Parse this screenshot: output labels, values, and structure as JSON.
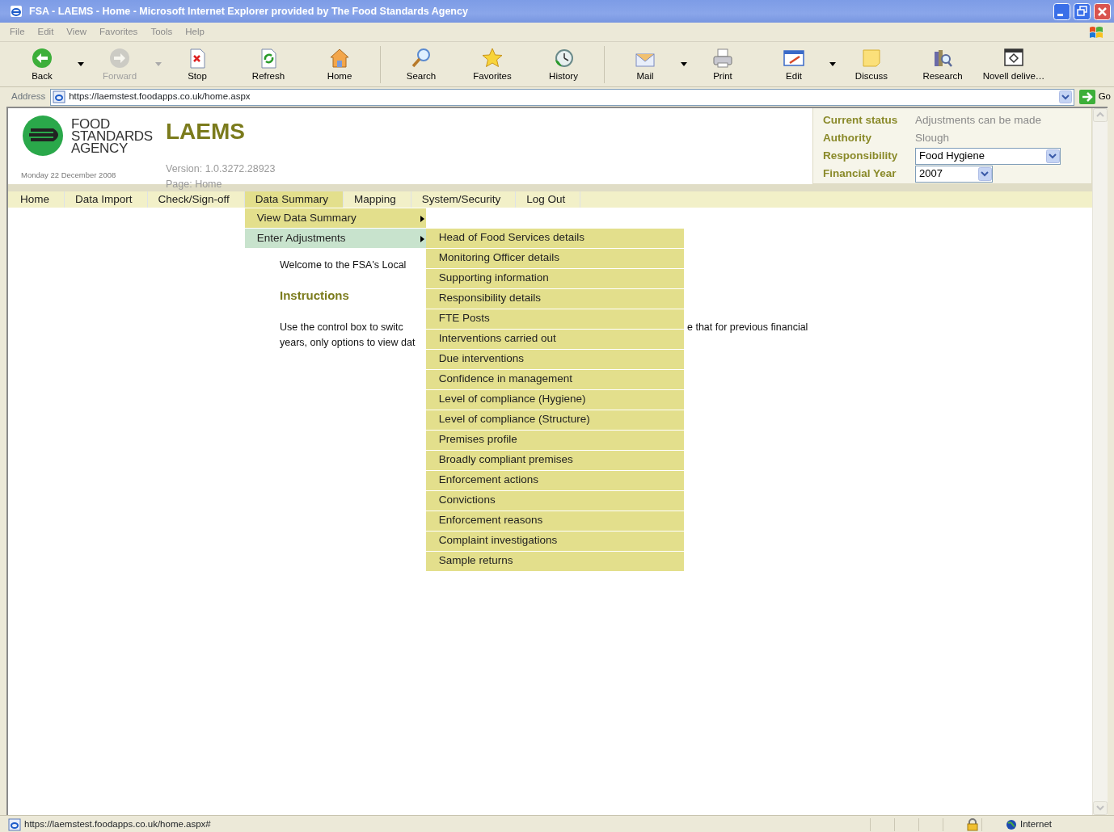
{
  "window": {
    "title": "FSA - LAEMS - Home - Microsoft Internet Explorer provided by The Food Standards Agency"
  },
  "menu_bar": [
    "File",
    "Edit",
    "View",
    "Favorites",
    "Tools",
    "Help"
  ],
  "toolbar": [
    [
      {
        "kind": "back",
        "label": "Back",
        "disabled": false,
        "dropdown": true
      },
      {
        "kind": "forward",
        "label": "Forward",
        "disabled": true,
        "dropdown": true
      },
      {
        "kind": "stop",
        "label": "Stop",
        "disabled": false,
        "dropdown": false
      },
      {
        "kind": "refresh",
        "label": "Refresh",
        "disabled": false,
        "dropdown": false
      },
      {
        "kind": "home",
        "label": "Home",
        "disabled": false,
        "dropdown": false
      }
    ],
    [
      {
        "kind": "search",
        "label": "Search",
        "disabled": false,
        "dropdown": false
      },
      {
        "kind": "favorites",
        "label": "Favorites",
        "disabled": false,
        "dropdown": false
      },
      {
        "kind": "history",
        "label": "History",
        "disabled": false,
        "dropdown": false
      }
    ],
    [
      {
        "kind": "mail",
        "label": "Mail",
        "disabled": false,
        "dropdown": true
      },
      {
        "kind": "print",
        "label": "Print",
        "disabled": false,
        "dropdown": false
      },
      {
        "kind": "edit",
        "label": "Edit",
        "disabled": false,
        "dropdown": true
      },
      {
        "kind": "discuss",
        "label": "Discuss",
        "disabled": false,
        "dropdown": false
      },
      {
        "kind": "research",
        "label": "Research",
        "disabled": false,
        "dropdown": false
      },
      {
        "kind": "novell",
        "label": "Novell delive…",
        "disabled": false,
        "dropdown": false
      }
    ]
  ],
  "address_bar": {
    "label": "Address",
    "url": "https://laemstest.foodapps.co.uk/home.aspx",
    "go": "Go"
  },
  "header": {
    "logo_lines": [
      "FOOD",
      "STANDARDS",
      "AGENCY"
    ],
    "date": "Monday 22 December 2008",
    "app_title": "LAEMS",
    "version": "Version: 1.0.3272.28923",
    "page": "Page: Home"
  },
  "status_panel": [
    {
      "kind": "text",
      "label": "Current status",
      "value": "Adjustments can be made"
    },
    {
      "kind": "text",
      "label": "Authority",
      "value": "Slough"
    },
    {
      "kind": "select",
      "label": "Responsibility",
      "value": "Food Hygiene"
    },
    {
      "kind": "select_small",
      "label": "Financial Year",
      "value": "2007"
    }
  ],
  "nav": [
    {
      "label": "Home",
      "selected": false
    },
    {
      "label": "Data Import",
      "selected": false
    },
    {
      "label": "Check/Sign-off",
      "selected": false
    },
    {
      "label": "Data Summary",
      "selected": true
    },
    {
      "label": "Mapping",
      "selected": false
    },
    {
      "label": "System/Security",
      "selected": false
    },
    {
      "label": "Log Out",
      "selected": false
    }
  ],
  "dropdown": [
    {
      "label": "View Data Summary",
      "selected": false,
      "submenu": true
    },
    {
      "label": "Enter Adjustments",
      "selected": true,
      "submenu": true
    }
  ],
  "submenu": [
    "Head of Food Services details",
    "Monitoring Officer details",
    "Supporting information",
    "Responsibility details",
    "FTE Posts",
    "Interventions carried out",
    "Due interventions",
    "Confidence in management",
    "Level of compliance (Hygiene)",
    "Level of compliance (Structure)",
    "Premises profile",
    "Broadly compliant premises",
    "Enforcement actions",
    "Convictions",
    "Enforcement reasons",
    "Complaint investigations",
    "Sample returns"
  ],
  "content": {
    "welcome": "Welcome to the FSA's Local",
    "heading": "Instructions",
    "paragraph_left": [
      "Use the control box to switc",
      "years, only options to view dat"
    ],
    "paragraph_right": [
      "e that for previous financial"
    ]
  },
  "status_bar": {
    "url": "https://laemstest.foodapps.co.uk/home.aspx#",
    "zone": "Internet"
  }
}
